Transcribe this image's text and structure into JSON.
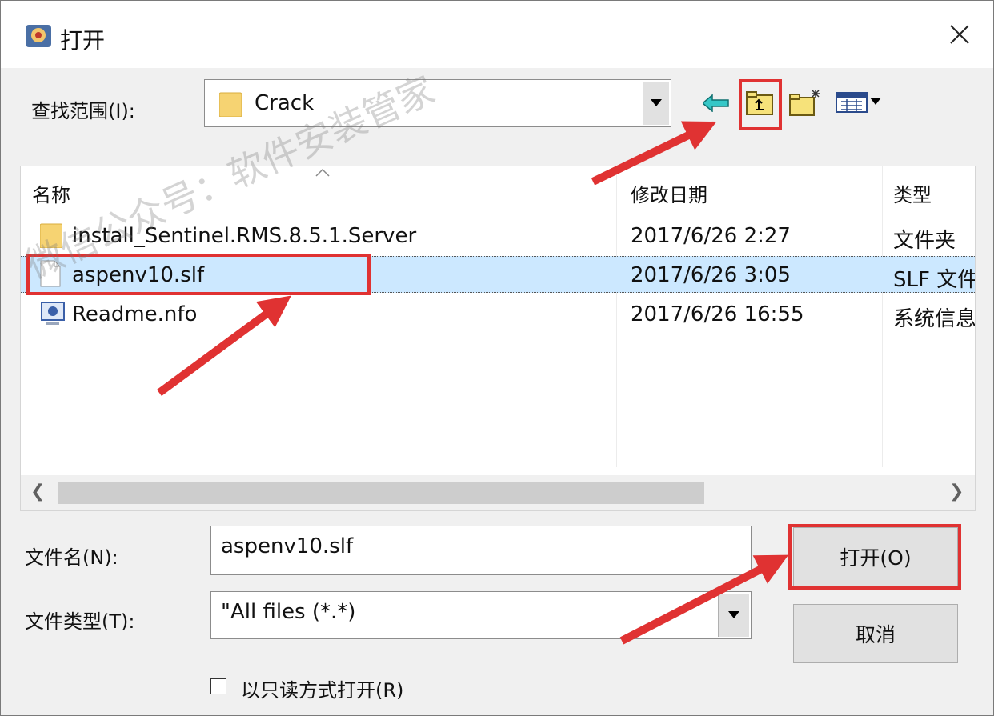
{
  "window": {
    "title": "打开"
  },
  "look_in": {
    "label": "查找范围(I):",
    "value": "Crack"
  },
  "toolbar": {
    "back_icon": "back-arrow-icon",
    "up_icon": "up-folder-icon",
    "new_folder_icon": "new-folder-icon",
    "view_icon": "view-menu-icon"
  },
  "file_list": {
    "columns": [
      "名称",
      "修改日期",
      "类型"
    ],
    "rows": [
      {
        "name": "install_Sentinel.RMS.8.5.1.Server",
        "date": "2017/6/26 2:27",
        "type": "文件夹",
        "icon": "folder-icon",
        "selected": false
      },
      {
        "name": "aspenv10.slf",
        "date": "2017/6/26 3:05",
        "type": "SLF 文件",
        "icon": "file-icon",
        "selected": true
      },
      {
        "name": "Readme.nfo",
        "date": "2017/6/26 16:55",
        "type": "系统信息",
        "icon": "system-info-icon",
        "selected": false
      }
    ]
  },
  "filename": {
    "label": "文件名(N):",
    "value": "aspenv10.slf"
  },
  "filetype": {
    "label": "文件类型(T):",
    "value": "\"All files (*.*)"
  },
  "buttons": {
    "open": "打开(O)",
    "cancel": "取消"
  },
  "readonly": {
    "label": "以只读方式打开(R)",
    "checked": false
  },
  "watermark": "微信公众号：软件安装管家",
  "colors": {
    "highlight": "#e03232",
    "selection": "#cce8ff",
    "folder": "#f6d372"
  }
}
